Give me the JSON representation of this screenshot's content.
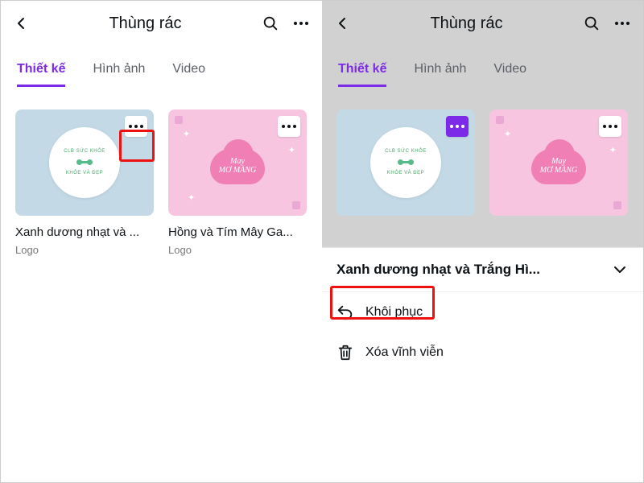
{
  "header": {
    "title": "Thùng rác"
  },
  "tabs": {
    "design": "Thiết kế",
    "images": "Hình ảnh",
    "video": "Video"
  },
  "cards": [
    {
      "title": "Xanh dương nhạt và ...",
      "type": "Logo",
      "logo_top": "CLB SỨC KHỎE",
      "logo_bottom": "KHỎE VÀ ĐẸP"
    },
    {
      "title": "Hồng và Tím Mây Ga...",
      "type": "Logo",
      "cloud_text": "May\nMƠ MÀNG"
    }
  ],
  "sheet": {
    "title": "Xanh dương nhạt và Trắng Hì...",
    "restore": "Khôi phục",
    "delete": "Xóa vĩnh viễn"
  },
  "colors": {
    "accent": "#7d2ae8",
    "highlight": "#e11"
  }
}
